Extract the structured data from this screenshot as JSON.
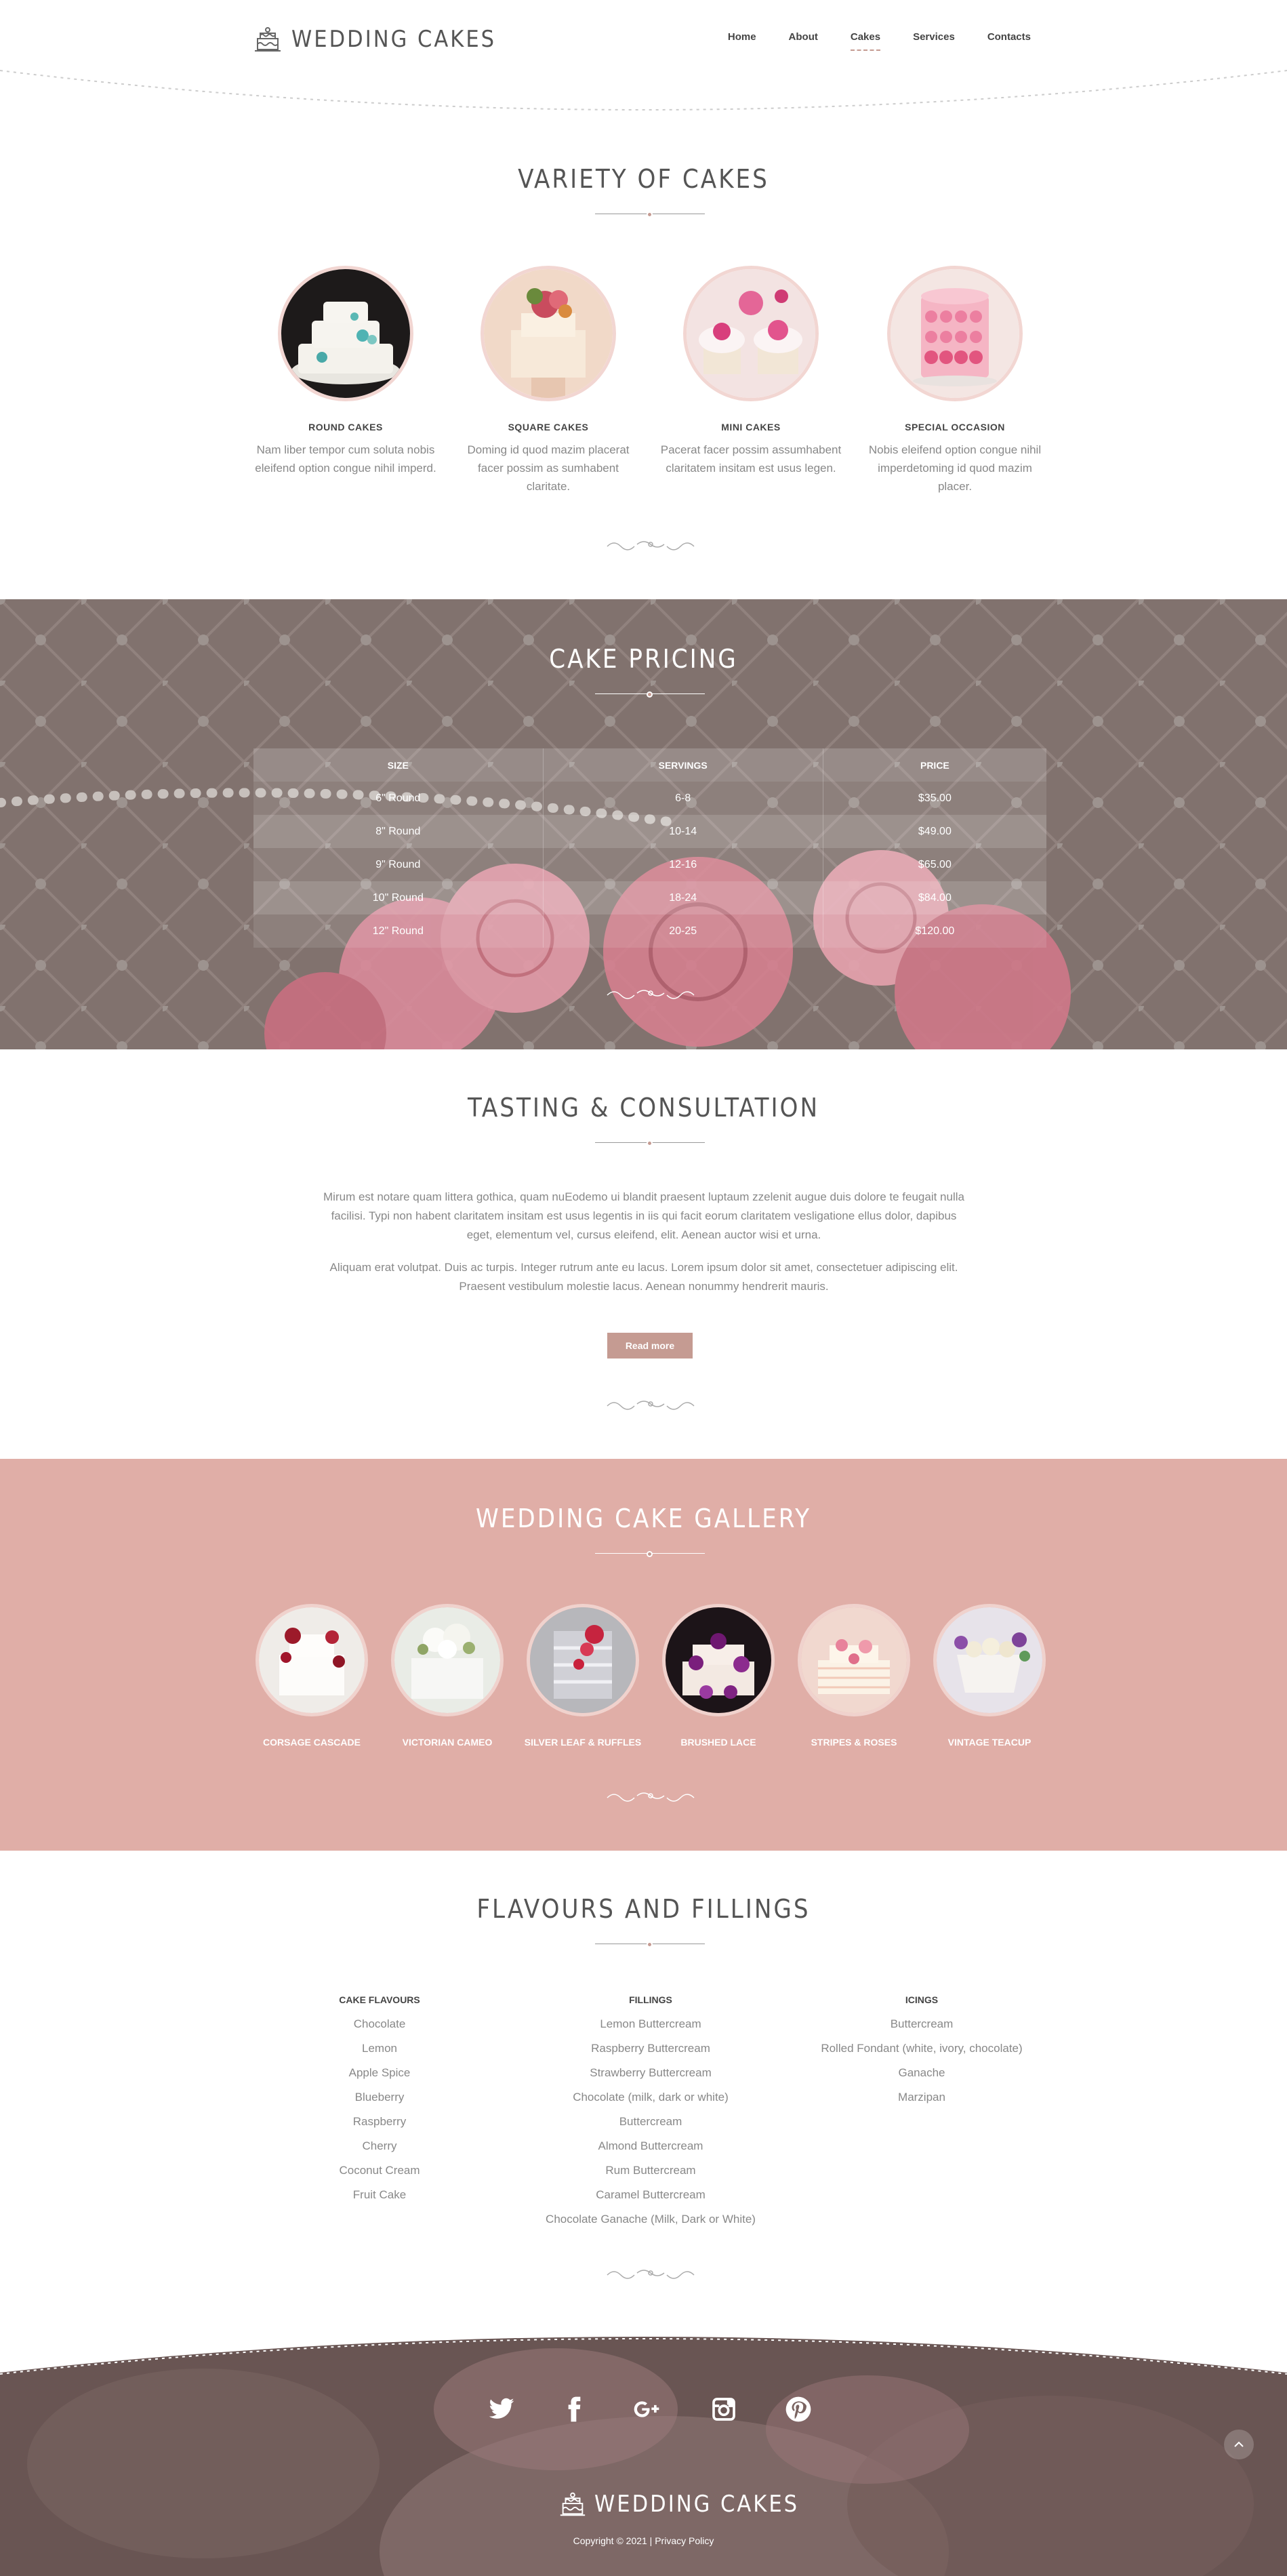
{
  "header": {
    "brand": "WEDDING CAKES",
    "nav": [
      "Home",
      "About",
      "Cakes",
      "Services",
      "Contacts"
    ],
    "active_nav": "Cakes"
  },
  "variety": {
    "title": "VARIETY OF CAKES",
    "cards": [
      {
        "title": "ROUND CAKES",
        "text": "Nam liber tempor cum soluta nobis eleifend option congue nihil imperd."
      },
      {
        "title": "SQUARE CAKES",
        "text": "Doming id quod mazim placerat facer possim as sumhabent claritate."
      },
      {
        "title": "MINI CAKES",
        "text": "Pacerat facer possim assumhabent claritatem insitam est usus legen."
      },
      {
        "title": "SPECIAL OCCASION",
        "text": "Nobis eleifend option congue nihil imperdetoming id quod mazim placer."
      }
    ]
  },
  "pricing": {
    "title": "CAKE PRICING",
    "columns": [
      "SIZE",
      "SERVINGS",
      "PRICE"
    ],
    "rows": [
      [
        "6\" Round",
        "6-8",
        "$35.00"
      ],
      [
        "8\" Round",
        "10-14",
        "$49.00"
      ],
      [
        "9\" Round",
        "12-16",
        "$65.00"
      ],
      [
        "10\" Round",
        "18-24",
        "$84.00"
      ],
      [
        "12\" Round",
        "20-25",
        "$120.00"
      ]
    ]
  },
  "tasting": {
    "title": "TASTING & CONSULTATION",
    "paragraph1": "Mirum est notare quam littera gothica, quam nuEodemo ui blandit praesent luptaum zzelenit augue duis dolore te feugait nulla facilisi. Typi non habent claritatem insitam est usus legentis in iis qui facit eorum claritatem vesligatione ellus dolor, dapibus eget, elementum vel, cursus eleifend, elit. Aenean auctor wisi et urna.",
    "paragraph2": "Aliquam erat volutpat. Duis ac turpis. Integer rutrum ante eu lacus. Lorem ipsum dolor sit amet, consectetuer adipiscing elit. Praesent vestibulum molestie lacus. Aenean nonummy hendrerit mauris.",
    "button": "Read more"
  },
  "gallery": {
    "title": "WEDDING CAKE GALLERY",
    "items": [
      "CORSAGE CASCADE",
      "VICTORIAN CAMEO",
      "SILVER LEAF & RUFFLES",
      "BRUSHED LACE",
      "STRIPES & ROSES",
      "VINTAGE TEACUP"
    ]
  },
  "flavours": {
    "title": "FLAVOURS AND FILLINGS",
    "columns": [
      {
        "heading": "CAKE FLAVOURS",
        "items": [
          "Chocolate",
          "Lemon",
          "Apple Spice",
          "Blueberry",
          "Raspberry",
          "Cherry",
          "Coconut Cream",
          "Fruit Cake"
        ]
      },
      {
        "heading": "FILLINGS",
        "items": [
          "Lemon Buttercream",
          "Raspberry Buttercream",
          "Strawberry Buttercream",
          "Chocolate (milk, dark or white)",
          "Buttercream",
          "Almond Buttercream",
          "Rum Buttercream",
          "Caramel Buttercream",
          "Chocolate Ganache (Milk, Dark or White)"
        ]
      },
      {
        "heading": "ICINGS",
        "items": [
          "Buttercream",
          "Rolled Fondant (white, ivory, chocolate)",
          "Ganache",
          "Marzipan"
        ]
      }
    ]
  },
  "footer": {
    "social": [
      "twitter-icon",
      "facebook-icon",
      "google-plus-icon",
      "instagram-icon",
      "pinterest-icon"
    ],
    "brand": "WEDDING CAKES",
    "copyright": "Copyright © 2021 | Privacy Policy"
  },
  "colors": {
    "accent": "#c59b92",
    "gallery_bg": "#e0aea7",
    "text": "#888888"
  }
}
